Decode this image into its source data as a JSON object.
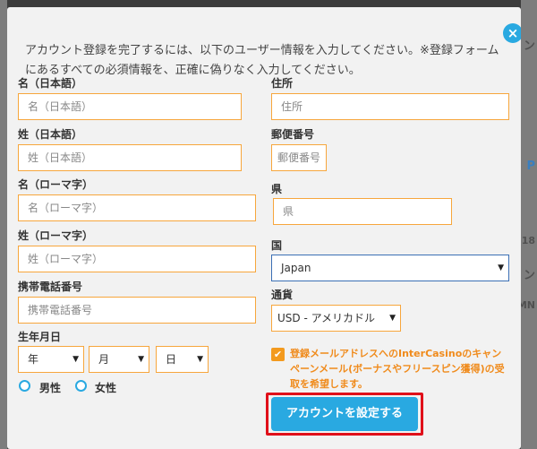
{
  "background": {
    "right_fragments": [
      "ン",
      "P",
      "18",
      "ン",
      "MN"
    ]
  },
  "modal": {
    "close_icon": "×",
    "intro": "アカウント登録を完了するには、以下のユーザー情報を入力してください。※登録フォームにあるすべての必須情報を、正確に偽りなく入力してください。",
    "fields": {
      "first_name_ja": {
        "label": "名（日本語）",
        "placeholder": "名（日本語）"
      },
      "last_name_ja": {
        "label": "姓（日本語）",
        "placeholder": "姓（日本語）"
      },
      "first_name_roman": {
        "label": "名（ローマ字）",
        "placeholder": "名（ローマ字）"
      },
      "last_name_roman": {
        "label": "姓（ローマ字）",
        "placeholder": "姓（ローマ字）"
      },
      "mobile": {
        "label": "携帯電話番号",
        "placeholder": "携帯電話番号"
      },
      "address": {
        "label": "住所",
        "placeholder": "住所"
      },
      "postal": {
        "label": "郵便番号",
        "placeholder": "郵便番号"
      },
      "prefecture": {
        "label": "県",
        "placeholder": "県"
      },
      "country": {
        "label": "国",
        "value": "Japan"
      },
      "currency": {
        "label": "通貨",
        "value": "USD - アメリカドル"
      }
    },
    "birthdate": {
      "label": "生年月日",
      "year": "年",
      "month": "月",
      "day": "日"
    },
    "gender": {
      "male": "男性",
      "female": "女性"
    },
    "newsletter": {
      "checked": true,
      "text": "登録メールアドレスへのInterCasinoのキャンペーンメール(ボーナスやフリースピン獲得)の受取を希望します。"
    },
    "submit_label": "アカウントを設定する"
  },
  "colors": {
    "accent": "#29a9e1",
    "input_border": "#f7a63c",
    "checkbox": "#f39a1e",
    "highlight_frame": "#e0101a"
  }
}
